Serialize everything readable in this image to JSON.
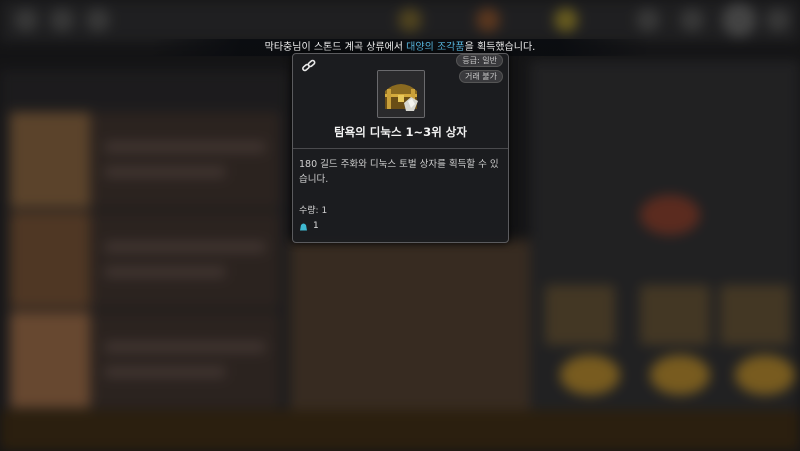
{
  "notification": {
    "prefix": "막타충님이 스톤드 계곡 상류에서 ",
    "highlight": "대양의 조각품",
    "suffix": "을 획득했습니다.",
    "highlight_color": "#58b8e0"
  },
  "tooltip": {
    "link_icon": "chain-link-icon",
    "grade_label": "등급: 일반",
    "trade_label": "거래 불가",
    "item_icon": "treasure-chest-icon",
    "item_name": "탐욕의 디눅스 1~3위 상자",
    "description": "180 길드 주화와 디눅스 토벌 상자를 획득할 수 있습니다.",
    "quantity_label": "수량: 1",
    "owned_icon": "bag-icon",
    "owned_count": "1"
  }
}
